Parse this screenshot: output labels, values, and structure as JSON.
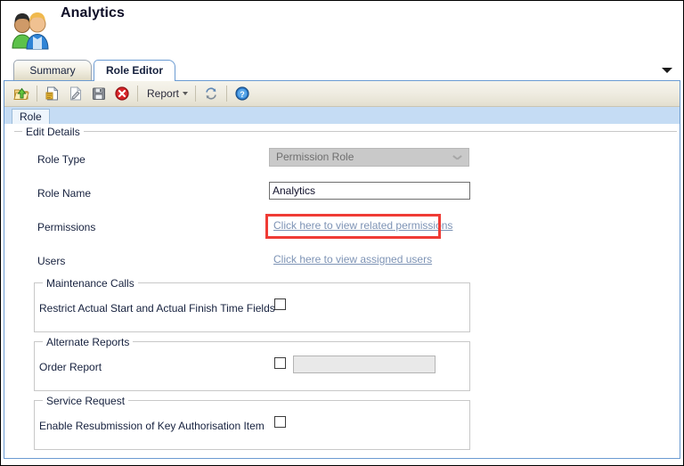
{
  "header": {
    "title": "Analytics",
    "icon": "users-pair-icon"
  },
  "tabs": [
    {
      "label": "Summary",
      "active": false
    },
    {
      "label": "Role Editor",
      "active": true
    }
  ],
  "tab_overflow_icon": "chevron-down-icon",
  "toolbar": {
    "items": [
      {
        "name": "open-folder-up-icon",
        "label": ""
      },
      {
        "name": "new-document-icon",
        "label": ""
      },
      {
        "name": "edit-document-icon",
        "label": ""
      },
      {
        "name": "save-icon",
        "label": ""
      },
      {
        "name": "delete-icon",
        "label": ""
      }
    ],
    "report_label": "Report",
    "report_dropdown_icon": "caret-down-icon",
    "refresh_icon": "refresh-icon",
    "help_icon": "help-icon"
  },
  "inner_tab": {
    "label": "Role"
  },
  "form": {
    "edit_details_legend": "Edit Details",
    "role_type": {
      "label": "Role Type",
      "value": "Permission Role",
      "disabled": true,
      "chevron_icon": "chevron-down-icon"
    },
    "role_name": {
      "label": "Role Name",
      "value": "Analytics",
      "placeholder": ""
    },
    "permissions": {
      "label": "Permissions",
      "link_text": "Click here to view related permissions",
      "highlighted": true
    },
    "users": {
      "label": "Users",
      "link_text": "Click here to view assigned users",
      "highlighted": false
    }
  },
  "groups": [
    {
      "legend": "Maintenance Calls",
      "row_label": "Restrict Actual Start and Actual Finish Time Fields",
      "checked": false,
      "has_textbox": false,
      "textbox_value": ""
    },
    {
      "legend": "Alternate Reports",
      "row_label": "Order Report",
      "checked": false,
      "has_textbox": true,
      "textbox_value": ""
    },
    {
      "legend": "Service Request",
      "row_label": "Enable Resubmission of Key Authorisation Item",
      "checked": false,
      "has_textbox": false,
      "textbox_value": ""
    }
  ],
  "colors": {
    "highlight": "#ef3b35",
    "link": "#7d93b5",
    "tab_active_border": "#6b9bd2",
    "inner_tab_bar": "#c5dcf4"
  }
}
